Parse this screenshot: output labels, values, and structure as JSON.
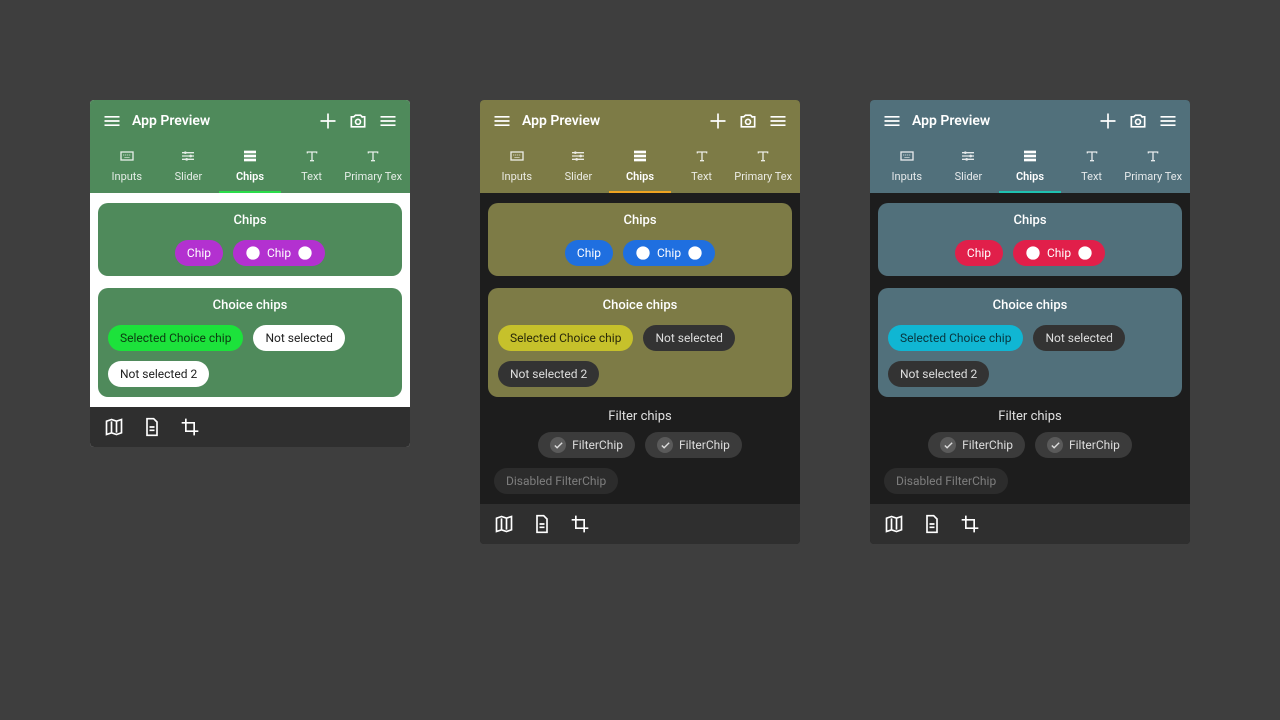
{
  "app_title": "App Preview",
  "tabs": [
    "Inputs",
    "Slider",
    "Chips",
    "Text",
    "Primary Tex"
  ],
  "active_tab_index": 2,
  "cards": {
    "chips": {
      "title": "Chips",
      "chip1": "Chip",
      "chip2": "Chip"
    },
    "choice": {
      "title": "Choice chips",
      "selected": "Selected Choice chip",
      "n1": "Not selected",
      "n2": "Not selected 2"
    },
    "filter": {
      "title": "Filter chips",
      "f1": "FilterChip",
      "f2": "FilterChip",
      "f3": "Disabled FilterChip"
    }
  },
  "themes": [
    {
      "id": "green",
      "light": true,
      "show_filter": false,
      "header": "#4f8a5b",
      "tab_underline": "#2bdc4a",
      "card_bg": "#4f8a5b",
      "card_text": "#ffffff",
      "chip_primary_bg": "#b331d0",
      "chip_primary_fg": "#ffffff",
      "choice_sel_bg": "#1ce23b",
      "choice_sel_fg": "#0b3d11",
      "choice_unsel_bg": "#ffffff",
      "choice_unsel_fg": "#222222",
      "filter_bg": "#3b3b3b",
      "filter_fg": "#dddddd",
      "content_bg": "#ffffff"
    },
    {
      "id": "olive",
      "light": false,
      "show_filter": true,
      "header": "#7d7b46",
      "tab_underline": "#eea321",
      "card_bg": "#7d7b46",
      "card_text": "#ffffff",
      "chip_primary_bg": "#1f6fe0",
      "chip_primary_fg": "#ffffff",
      "choice_sel_bg": "#c6c12b",
      "choice_sel_fg": "#2b2a09",
      "choice_unsel_bg": "#333333",
      "choice_unsel_fg": "#dddddd",
      "filter_bg": "#3b3b3b",
      "filter_fg": "#dddddd",
      "content_bg": "#1d1d1d"
    },
    {
      "id": "teal",
      "light": false,
      "show_filter": true,
      "header": "#51707b",
      "tab_underline": "#1fc0b0",
      "card_bg": "#51707b",
      "card_text": "#ffffff",
      "chip_primary_bg": "#e11f4a",
      "chip_primary_fg": "#ffffff",
      "choice_sel_bg": "#10b6d3",
      "choice_sel_fg": "#073740",
      "choice_unsel_bg": "#333333",
      "choice_unsel_fg": "#dddddd",
      "filter_bg": "#3b3b3b",
      "filter_fg": "#dddddd",
      "content_bg": "#1d1d1d"
    }
  ]
}
